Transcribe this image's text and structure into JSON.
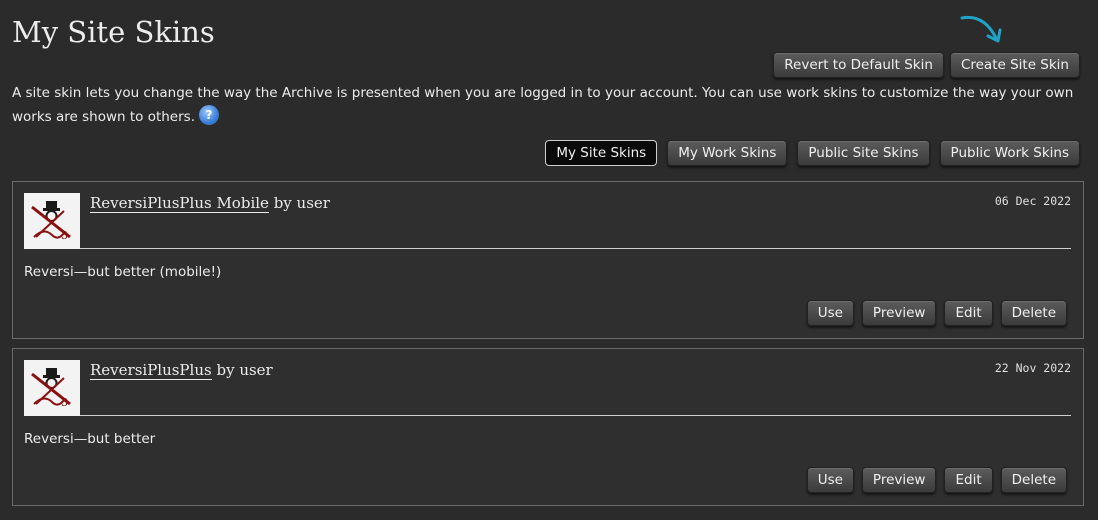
{
  "page": {
    "title": "My Site Skins",
    "intro": "A site skin lets you change the way the Archive is presented when you are logged in to your account. You can use work skins to customize the way your own works are shown to others.",
    "help_label": "?"
  },
  "actions": {
    "revert_label": "Revert to Default Skin",
    "create_label": "Create Site Skin"
  },
  "tabs": [
    {
      "label": "My Site Skins",
      "active": true
    },
    {
      "label": "My Work Skins",
      "active": false
    },
    {
      "label": "Public Site Skins",
      "active": false
    },
    {
      "label": "Public Work Skins",
      "active": false
    }
  ],
  "skins": [
    {
      "title": "ReversiPlusPlus Mobile",
      "by": "by user",
      "date": "06 Dec 2022",
      "summary": "Reversi—but better (mobile!)",
      "buttons": {
        "use": "Use",
        "preview": "Preview",
        "edit": "Edit",
        "delete": "Delete"
      }
    },
    {
      "title": "ReversiPlusPlus",
      "by": "by user",
      "date": "22 Nov 2022",
      "summary": "Reversi—but better",
      "buttons": {
        "use": "Use",
        "preview": "Preview",
        "edit": "Edit",
        "delete": "Delete"
      }
    }
  ],
  "colors": {
    "background": "#2b2b2b",
    "panel_border": "#6a6a6a",
    "arrow": "#1fa3c6",
    "active_tab": "#0a0a0a"
  },
  "icons": {
    "help": "help-question-icon",
    "thumbnail": "reversi-logo-icon",
    "arrow": "curved-arrow-icon"
  }
}
